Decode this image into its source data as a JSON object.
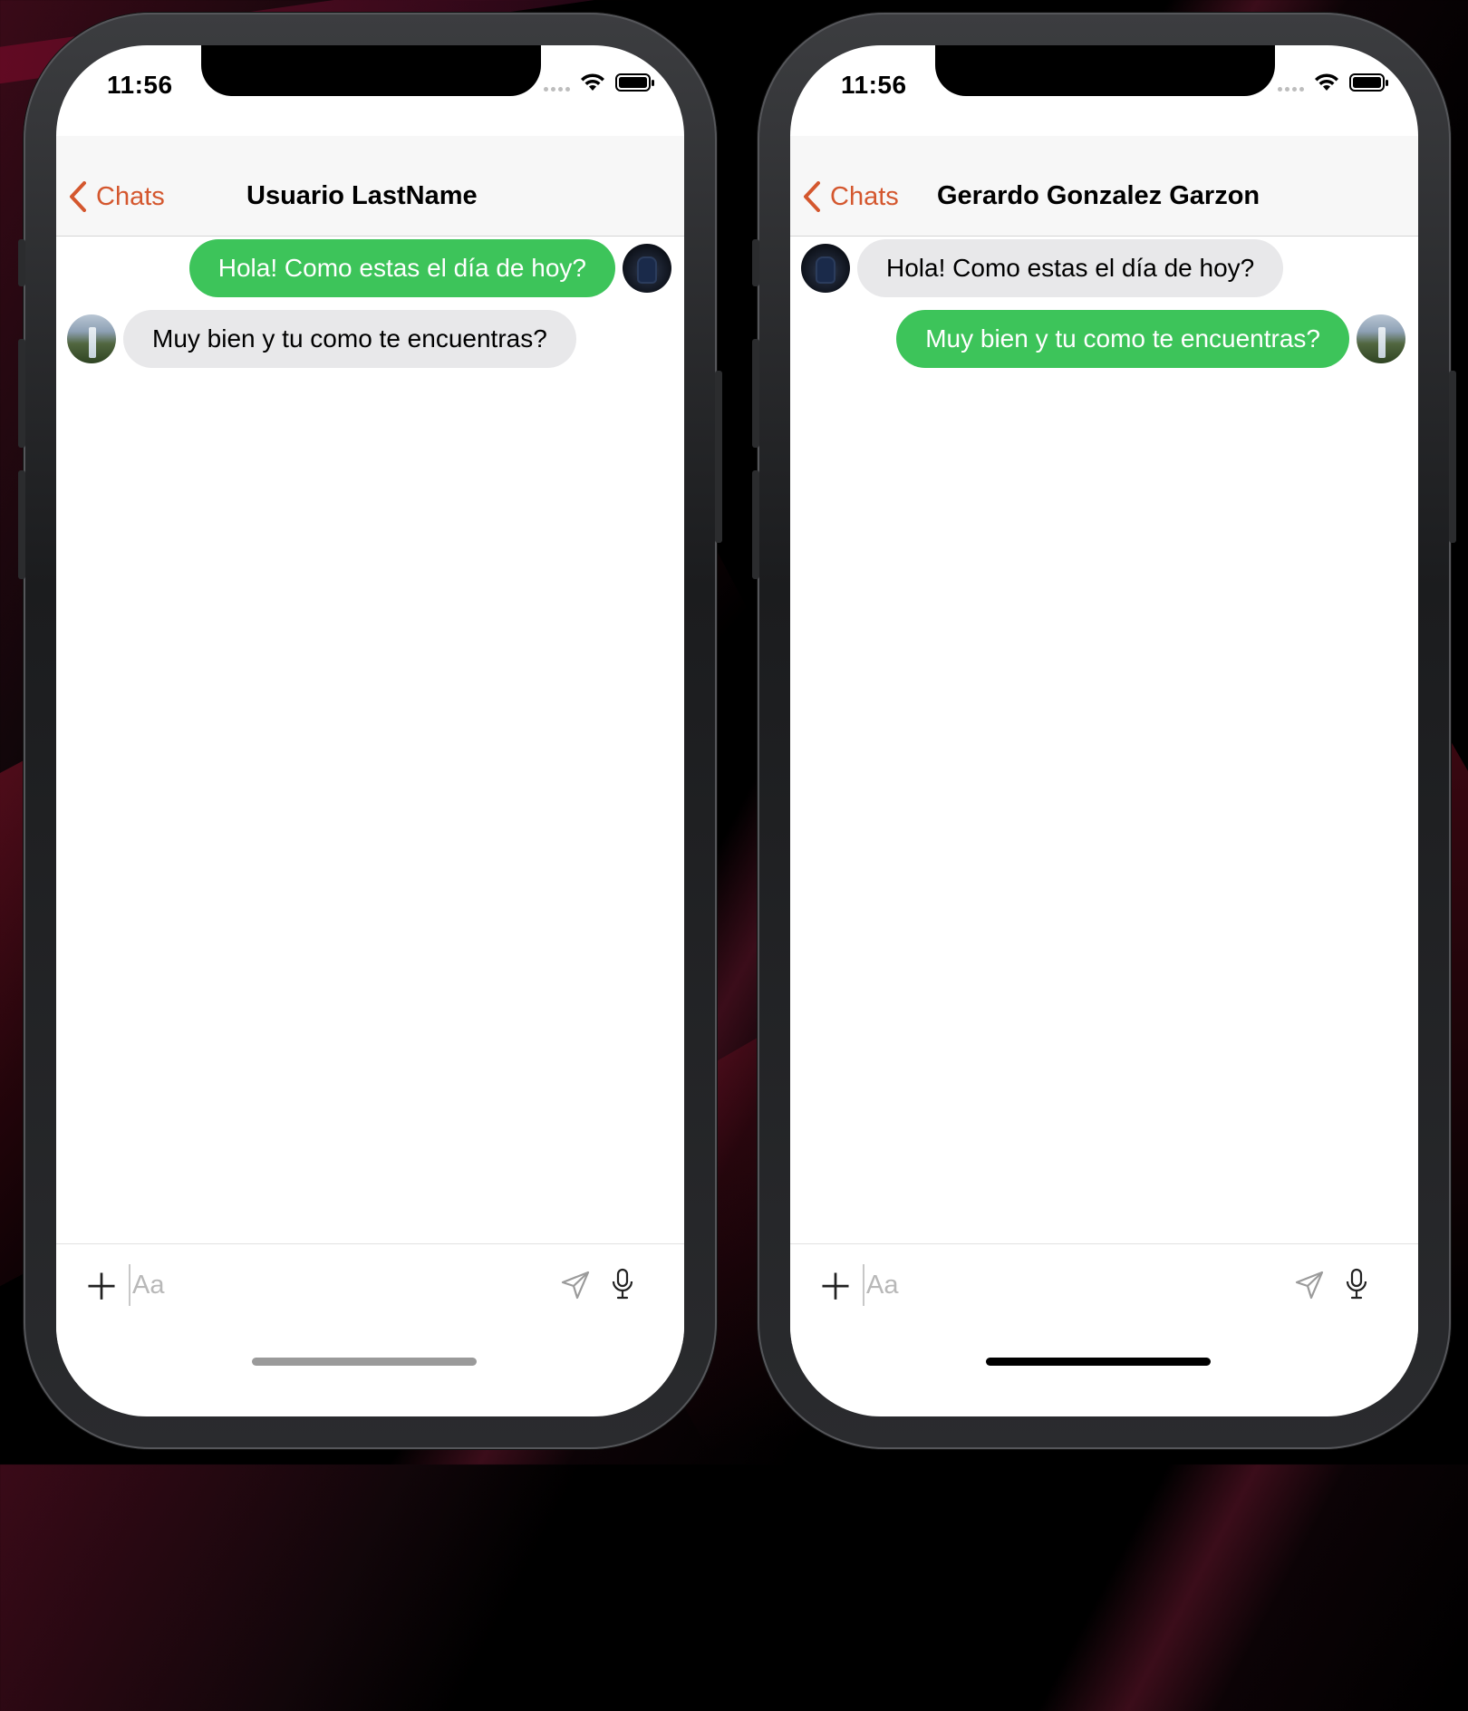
{
  "screens": [
    {
      "status_time": "11:56",
      "nav": {
        "back_label": "Chats",
        "title": "Usuario LastName"
      },
      "messages": [
        {
          "text": "Hola! Como estas el día de hoy?",
          "direction": "outgoing",
          "avatar": "night-portrait-avatar"
        },
        {
          "text": "Muy bien y tu como te encuentras?",
          "direction": "incoming",
          "avatar": "waterfall-avatar"
        }
      ],
      "composer": {
        "placeholder": "Aa"
      }
    },
    {
      "status_time": "11:56",
      "nav": {
        "back_label": "Chats",
        "title": "Gerardo Gonzalez Garzon"
      },
      "messages": [
        {
          "text": "Hola! Como estas el día de hoy?",
          "direction": "incoming",
          "avatar": "night-portrait-avatar"
        },
        {
          "text": "Muy bien y tu como te encuentras?",
          "direction": "outgoing",
          "avatar": "waterfall-avatar"
        }
      ],
      "composer": {
        "placeholder": "Aa"
      }
    }
  ],
  "colors": {
    "accent": "#d4572e",
    "outgoing_bubble": "#3dc45a",
    "incoming_bubble": "#e8e8ea",
    "home_indicator_left": "#9a9a9a",
    "home_indicator_right": "#000000"
  }
}
